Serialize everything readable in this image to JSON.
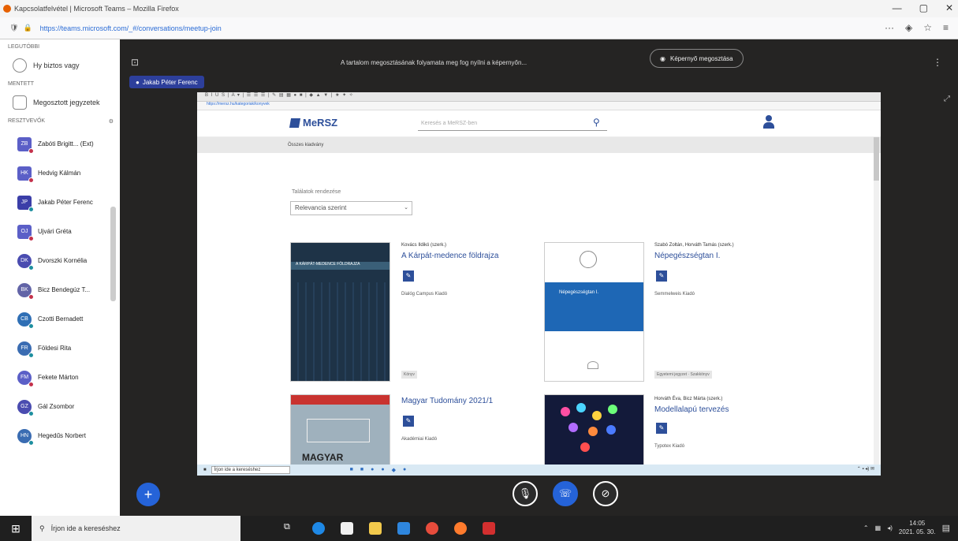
{
  "browser": {
    "title": "Kapcsolatfelvétel | Microsoft Teams – Mozilla Firefox",
    "url": "https://teams.microsoft.com/_#/conversations/meetup-join"
  },
  "sidebar": {
    "section_recent": "LEGUTÓBBI",
    "recent_item": "Hy biztos vagy",
    "section_saved": "MENTETT",
    "saved_item": "Megosztott jegyzetek",
    "section_contacts": "RESZTVEVŐK",
    "people": [
      {
        "initials": "ZB",
        "name": "Zabóti Brigitt... (Ext)",
        "color": "#5b5fc7",
        "status": "#c4314b",
        "square": true
      },
      {
        "initials": "HK",
        "name": "Hedvig Kálmán",
        "color": "#5b5fc7",
        "status": "#c4314b",
        "square": true
      },
      {
        "initials": "JP",
        "name": "Jakab Péter Ferenc",
        "color": "#3b3ea8",
        "status": "#1d8f9f",
        "square": true
      },
      {
        "initials": "OJ",
        "name": "Ujvári Gréta",
        "color": "#5b5fc7",
        "status": "#c4314b",
        "square": true
      },
      {
        "initials": "DK",
        "name": "Dvorszki Kornélia",
        "color": "#4a4cb0",
        "status": "#1d8f9f",
        "square": false
      },
      {
        "initials": "BK",
        "name": "Bicz Bendegúz T...",
        "color": "#6264a7",
        "status": "#c4314b",
        "square": false
      },
      {
        "initials": "CB",
        "name": "Czotti Bernadett",
        "color": "#2f6fb5",
        "status": "#1d8f9f",
        "square": false
      },
      {
        "initials": "FR",
        "name": "Földesi Rita",
        "color": "#3a6cb2",
        "status": "#1d8f9f",
        "square": false
      },
      {
        "initials": "FM",
        "name": "Fekete Márton",
        "color": "#5b5fc7",
        "status": "#c4314b",
        "square": false
      },
      {
        "initials": "GZ",
        "name": "Gál Zsombor",
        "color": "#4a4cb0",
        "status": "#1d8f9f",
        "square": false
      },
      {
        "initials": "HN",
        "name": "Hegedűs Norbert",
        "color": "#3a6cb2",
        "status": "#1d8f9f",
        "square": false
      }
    ]
  },
  "meeting": {
    "top_message": "A tartalom megosztásának folyamata meg fog nyílni a képernyőn...",
    "share_label": "Képernyő megosztása",
    "presenter": "Jakab Péter Ferenc"
  },
  "shared": {
    "toolbar": "B I U S | A ▾ | ☰ ☰ ☰ | ✎ ▤ ▦ ● ■ | ◆ ▲ ▼ | ★ ✦ ✧",
    "inner_url": "https://mersz.hu/kategoriak/konyvek",
    "logo": "MeRSZ",
    "search_placeholder": "Keresés a MeRSZ-ben",
    "breadcrumb": "Összes kiadvány",
    "sort_label": "Találatok rendezése",
    "sort_value": "Relevancia szerint",
    "cards": [
      {
        "author": "Kovács Ildikó (szerk.)",
        "title": "A Kárpát-medence földrajza",
        "sub": "Dialóg Campus Kiadó",
        "tag": "Könyv"
      },
      {
        "author": "Szabó Zoltán, Horváth Tamás (szerk.)",
        "title": "Népegészségtan I.",
        "sub": "Semmelweis Kiadó",
        "tag": "Egyetemi jegyzet · Szakkönyv"
      },
      {
        "author": "",
        "title": "Magyar Tudomány 2021/1",
        "sub": "Akadémiai Kiadó",
        "tag": ""
      },
      {
        "author": "Horváth Éva, Bicz Márta (szerk.)",
        "title": "Modellalapú tervezés",
        "sub": "Typotex Kiadó",
        "tag": ""
      }
    ],
    "cover_text_1": "A KÁRPÁT-MEDENCE FÖLDRAJZA",
    "cover_text_2": "Népegészségtan I.",
    "cover_text_3": "MAGYAR",
    "taskbar_search": "Írjon ide a kereséshez"
  },
  "taskbar": {
    "search": "Írjon ide a kereséshez",
    "time": "14:05",
    "date": "2021. 05. 30."
  }
}
